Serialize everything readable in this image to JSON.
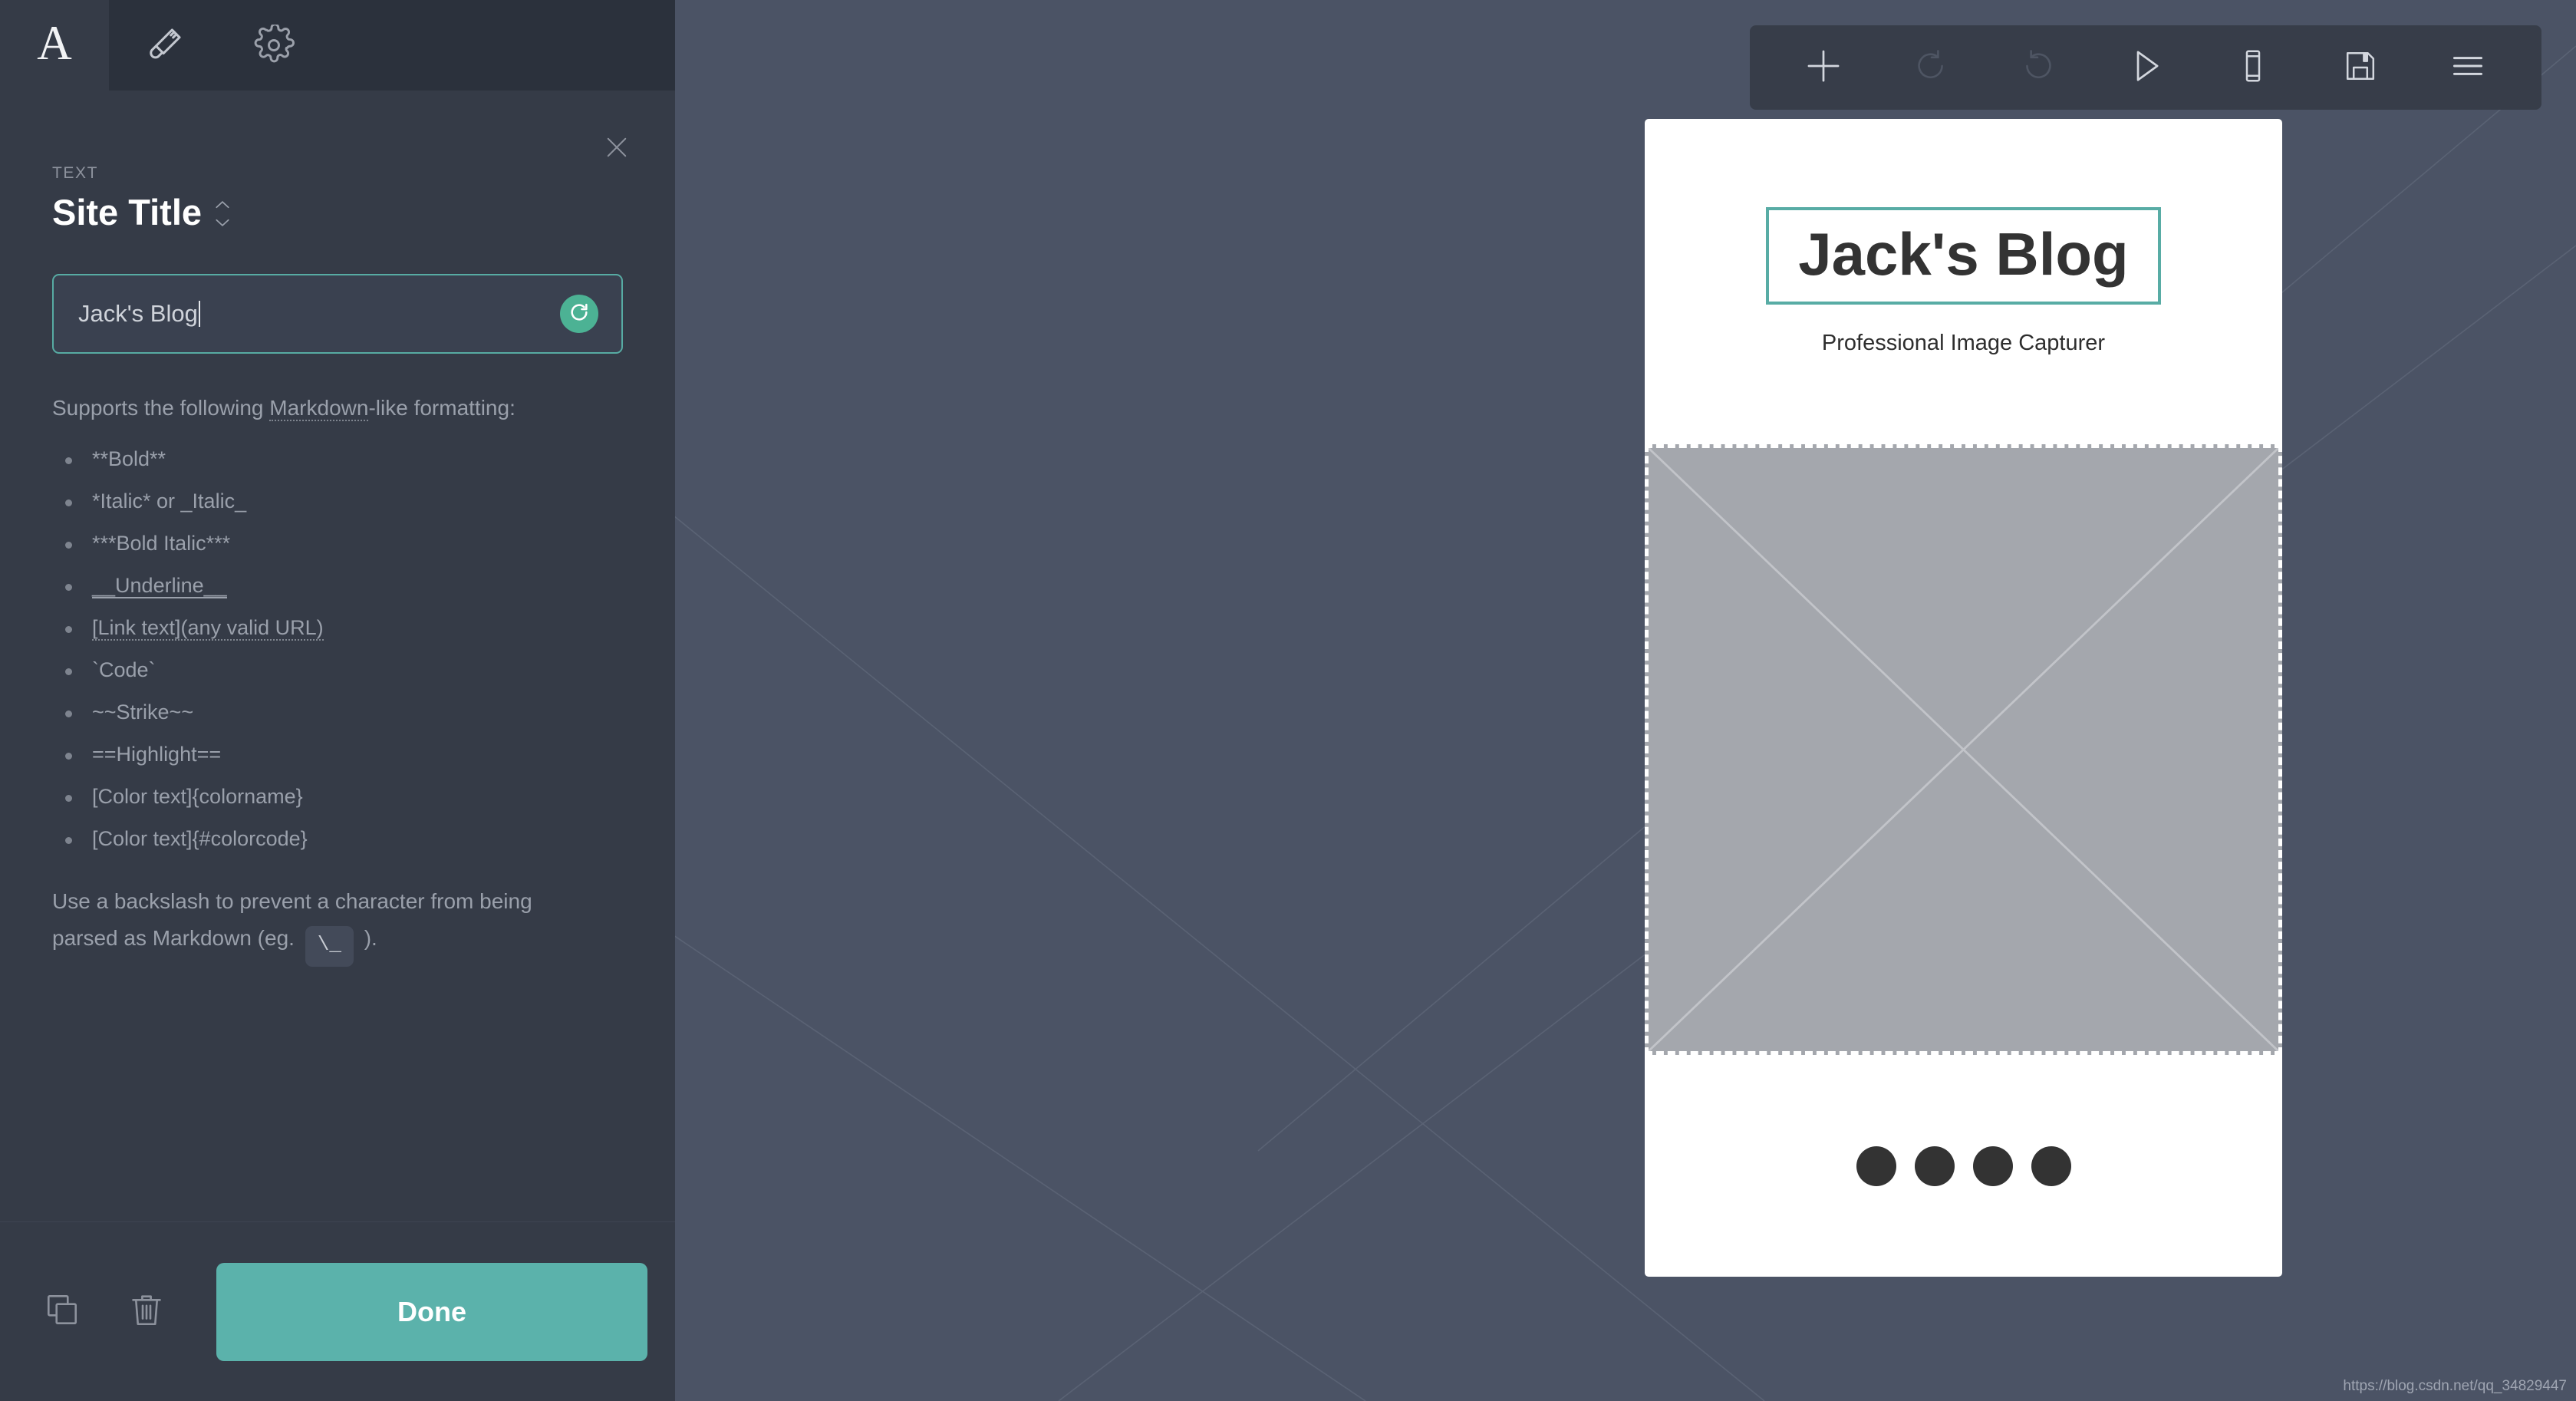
{
  "sidebar": {
    "tabs": [
      {
        "id": "text",
        "icon": "letter-a-icon",
        "label": "A",
        "active": true
      },
      {
        "id": "style",
        "icon": "paintbrush-icon",
        "label": "",
        "active": false
      },
      {
        "id": "settings",
        "icon": "gear-icon",
        "label": "",
        "active": false
      }
    ],
    "close_icon": "close-icon",
    "kicker": "TEXT",
    "title": "Site Title",
    "stepper_icon": "chevron-updown-icon",
    "input": {
      "value": "Jack's Blog",
      "placeholder": "Site Title",
      "reset_icon": "reset-icon"
    },
    "help": {
      "lead_before": "Supports the following ",
      "lead_term": "Markdown",
      "lead_after": "-like formatting:",
      "items": [
        "**Bold**",
        "*Italic* or _Italic_",
        "***Bold Italic***",
        "__Underline__",
        "[Link text](any valid URL)",
        "`Code`",
        "~~Strike~~",
        "==Highlight==",
        "[Color text]{colorname}",
        "[Color text]{#colorcode}"
      ],
      "footnote_before": "Use a backslash to prevent a character from being parsed as Markdown (eg. ",
      "footnote_code": "\\_",
      "footnote_after": " )."
    },
    "footer": {
      "duplicate_icon": "duplicate-icon",
      "delete_icon": "trash-icon",
      "done_label": "Done"
    }
  },
  "toolbar": {
    "buttons": [
      {
        "id": "add",
        "icon": "plus-icon",
        "disabled": false
      },
      {
        "id": "undo",
        "icon": "undo-icon",
        "disabled": true
      },
      {
        "id": "redo",
        "icon": "redo-icon",
        "disabled": true
      },
      {
        "id": "preview",
        "icon": "play-icon",
        "disabled": false
      },
      {
        "id": "device",
        "icon": "mobile-icon",
        "disabled": false
      },
      {
        "id": "save",
        "icon": "save-icon",
        "disabled": false
      },
      {
        "id": "menu",
        "icon": "hamburger-icon",
        "disabled": false
      }
    ]
  },
  "preview": {
    "site_title": "Jack's Blog",
    "tagline": "Professional Image Capturer",
    "image_placeholder_label": "",
    "social_dots": 4
  },
  "watermark": "https://blog.csdn.net/qq_34829447",
  "colors": {
    "panel_bg": "#353b47",
    "tabstrip_bg": "#2b313c",
    "canvas_bg": "#4b5365",
    "toolbar_bg": "#373d49",
    "accent_teal": "#5bb2ab",
    "accent_green": "#4cb294",
    "selection_border": "#58aca5",
    "muted_text": "#9aa0ab",
    "card_bg": "#ffffff",
    "placeholder_gray": "#a4a7ad",
    "social_dot": "#333333"
  }
}
